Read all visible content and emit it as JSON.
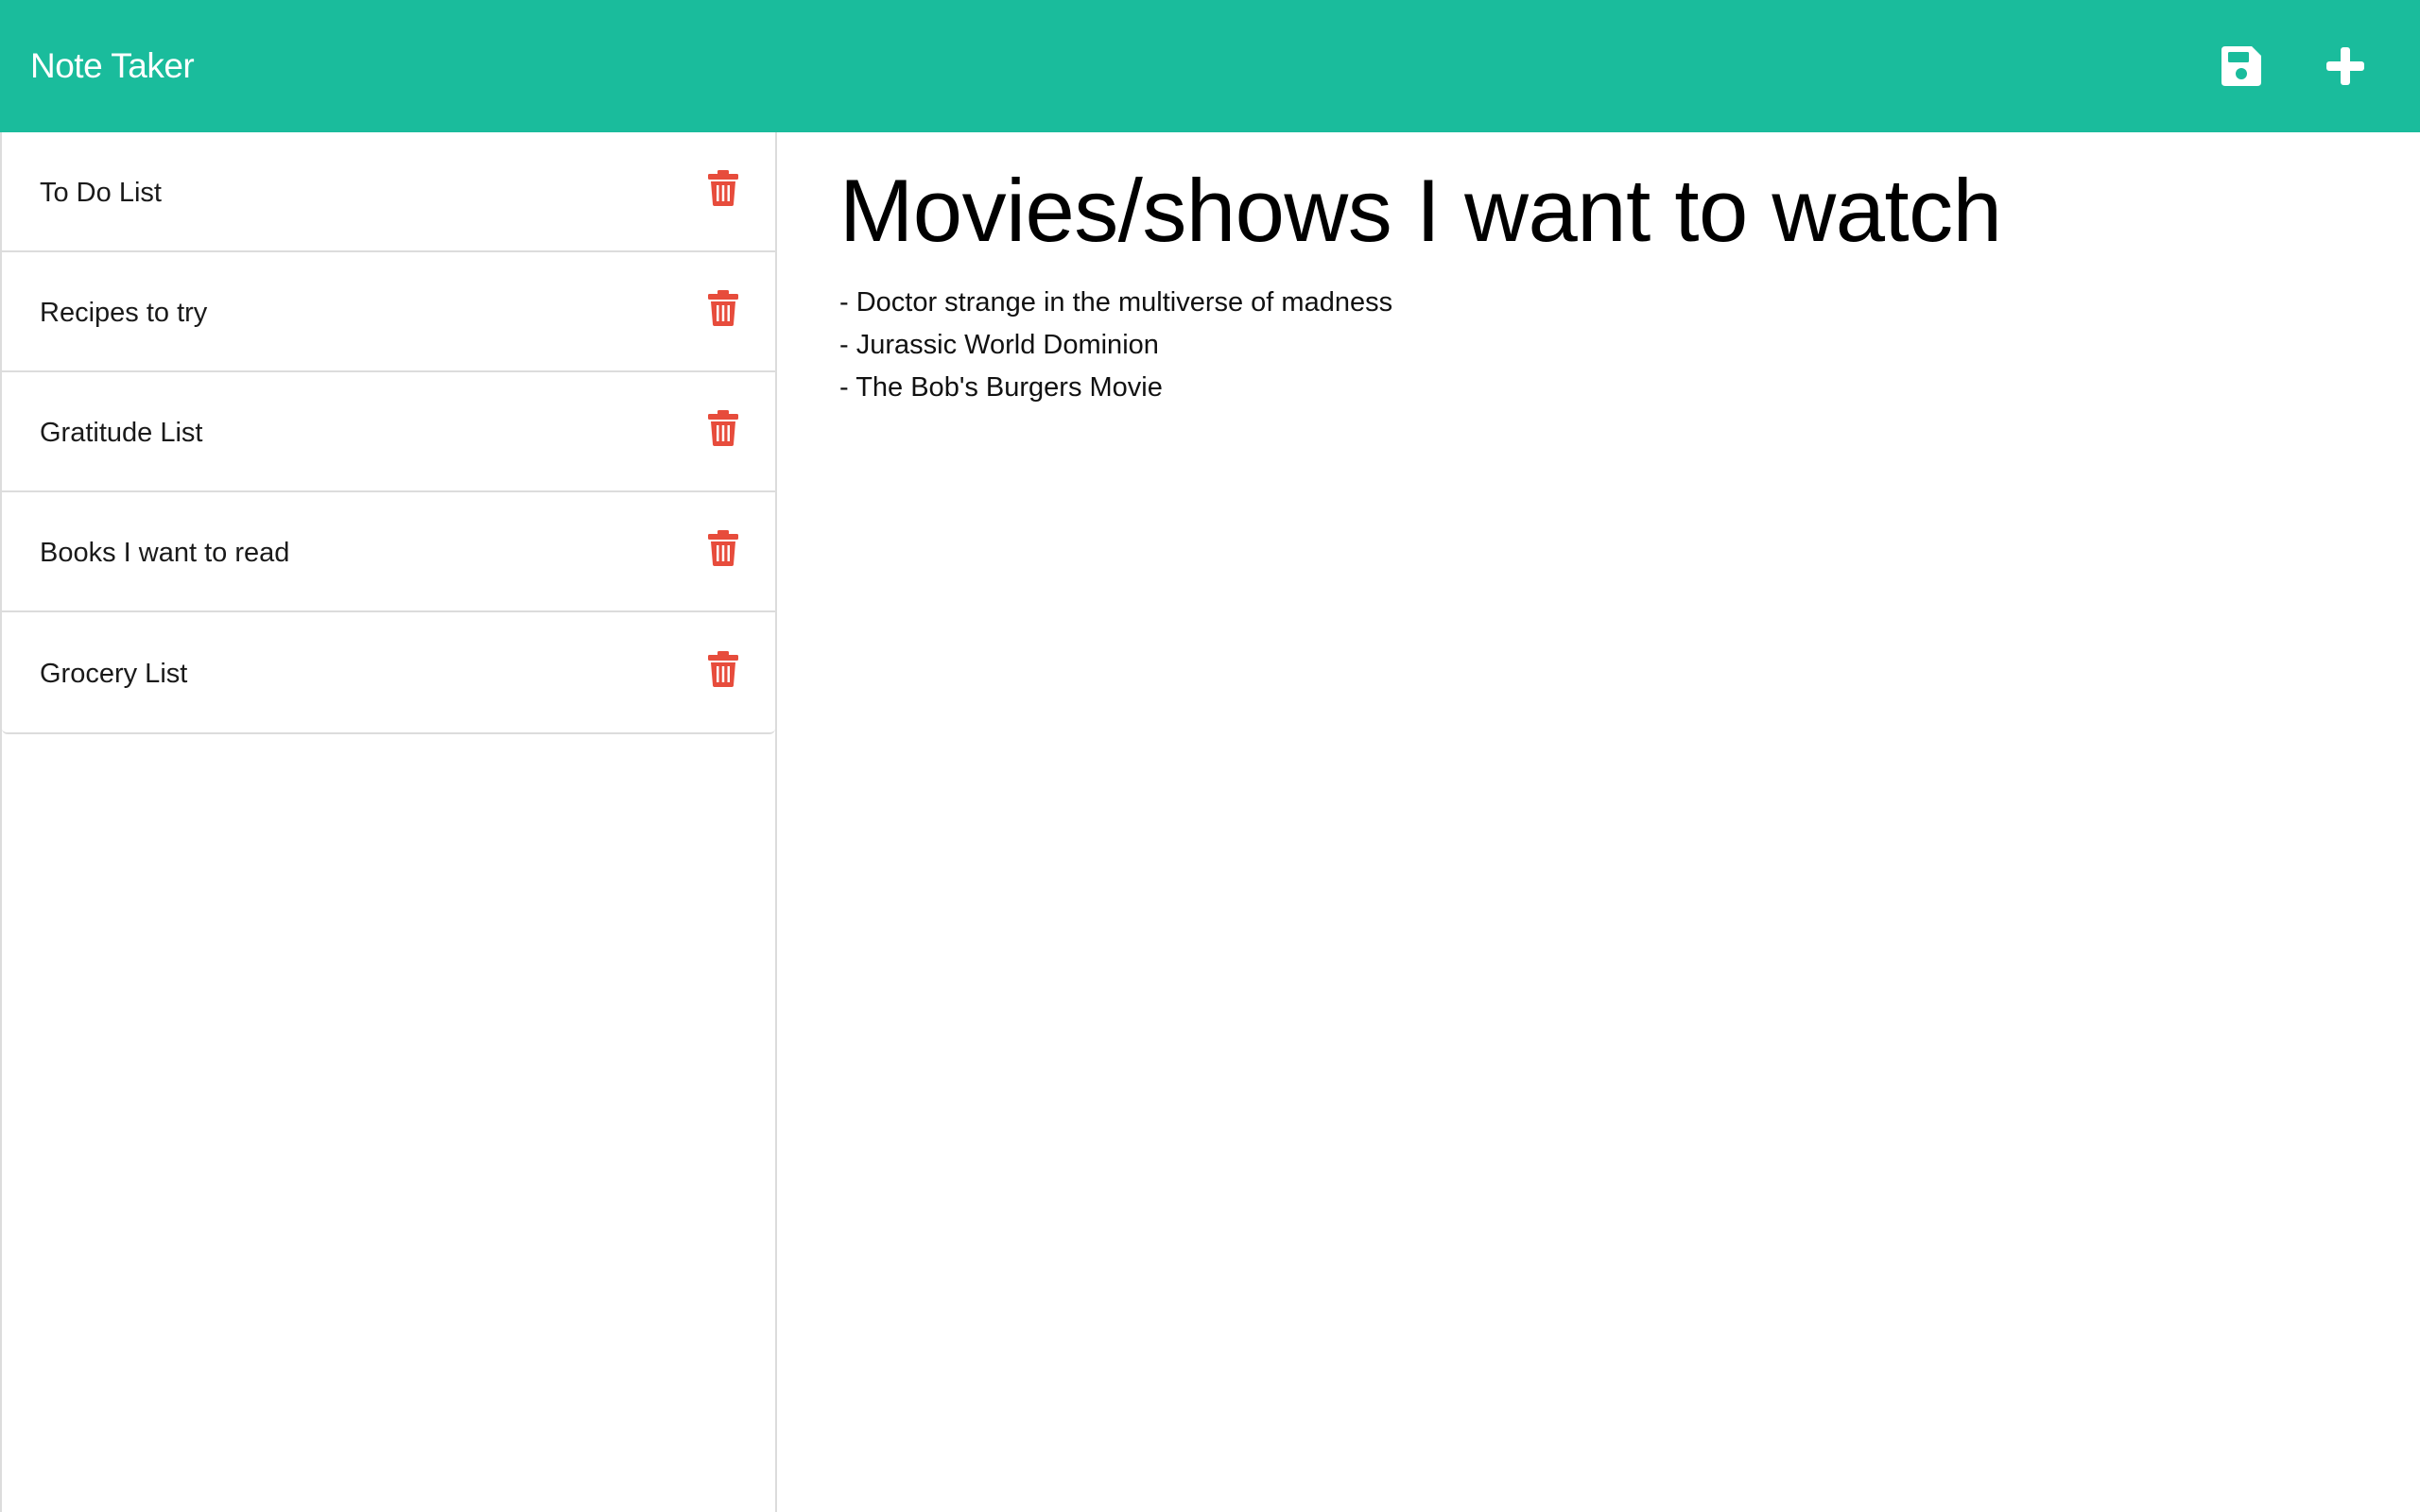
{
  "app": {
    "title": "Note Taker",
    "accent_color": "#1abc9c",
    "delete_color": "#e74c3c"
  },
  "toolbar": {
    "save_icon": "floppy-disk-icon",
    "new_icon": "plus-icon"
  },
  "sidebar": {
    "items": [
      {
        "label": "To Do List"
      },
      {
        "label": "Recipes to try"
      },
      {
        "label": "Gratitude List"
      },
      {
        "label": "Books I want to read"
      },
      {
        "label": "Grocery List"
      }
    ],
    "delete_icon": "trash-icon"
  },
  "note": {
    "title": "Movies/shows I want to watch",
    "lines": [
      "- Doctor strange in the multiverse of madness",
      "- Jurassic World Dominion",
      "- The Bob's Burgers Movie"
    ]
  }
}
